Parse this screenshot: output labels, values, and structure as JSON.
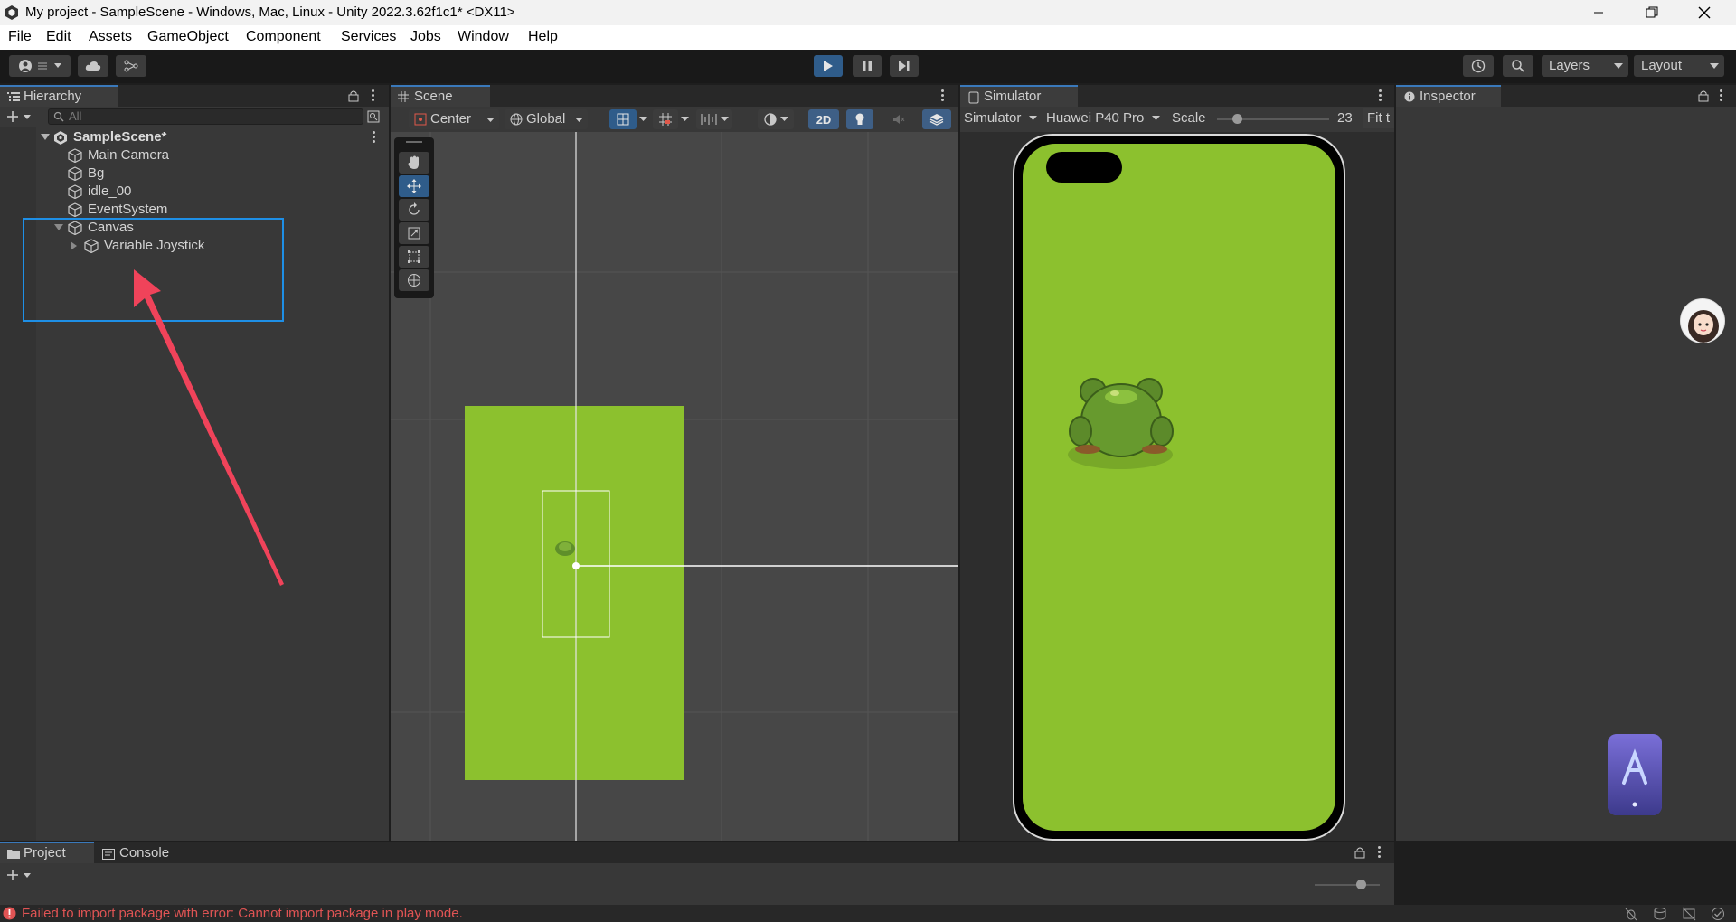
{
  "window": {
    "title": "My project - SampleScene - Windows, Mac, Linux - Unity 2022.3.62f1c1* <DX11>"
  },
  "menu": [
    "File",
    "Edit",
    "Assets",
    "GameObject",
    "Component",
    "Services",
    "Jobs",
    "Window",
    "Help"
  ],
  "toolbar": {
    "layers_label": "Layers",
    "layout_label": "Layout"
  },
  "hierarchy": {
    "tab_label": "Hierarchy",
    "search_placeholder": "All",
    "scene_name": "SampleScene*",
    "items": [
      "Main Camera",
      "Bg",
      "idle_00",
      "EventSystem",
      "Canvas",
      "Variable Joystick"
    ]
  },
  "scene": {
    "tab_label": "Scene",
    "pivot_label": "Center",
    "space_label": "Global",
    "mode_2d": "2D"
  },
  "simulator": {
    "tab_label": "Simulator",
    "mode_label": "Simulator",
    "device_label": "Huawei P40 Pro",
    "scale_label": "Scale",
    "scale_value": "23",
    "scale_fraction": 0.18,
    "fit_label": "Fit t"
  },
  "inspector": {
    "tab_label": "Inspector"
  },
  "bottom": {
    "project_tab": "Project",
    "console_tab": "Console"
  },
  "status": {
    "message": "Failed to import package with error: Cannot import package in play mode."
  },
  "colors": {
    "accent": "#3a79bb",
    "highlight_box": "#1e8fe6",
    "arrow": "#f0435a",
    "game_green": "#8cc12e",
    "error": "#e05454"
  }
}
